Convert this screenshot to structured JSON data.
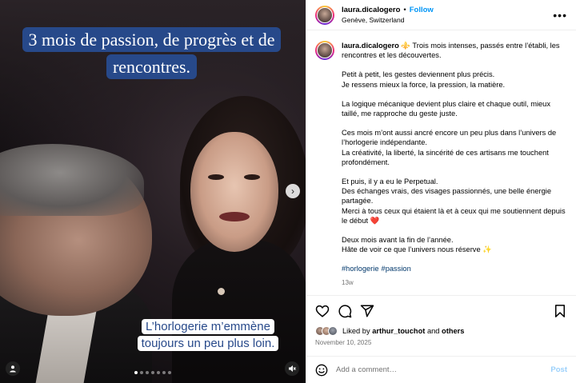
{
  "media": {
    "caption_top": "3 mois de passion, de progrès et de rencontres.",
    "caption_bottom": "L’horlogerie m’emmène toujours un peu plus loin.",
    "next_icon": "chevron-right-icon",
    "tag_icon": "user-tag-icon",
    "mute_icon": "speaker-muted-icon",
    "carousel_dots": 7,
    "active_dot": 0
  },
  "header": {
    "username": "laura.dicalogero",
    "separator": "•",
    "follow_label": "Follow",
    "location": "Genève, Switzerland",
    "more_icon": "more-horizontal-icon",
    "more_label": "•••"
  },
  "caption": {
    "username": "laura.dicalogero",
    "paragraphs": [
      "⚜️ Trois mois intenses, passés entre l’établi, les rencontres et les découvertes.",
      "Petit à petit, les gestes deviennent plus précis.\nJe ressens mieux la force, la pression, la matière.",
      "La logique mécanique devient plus claire et chaque outil, mieux taillé, me rapproche du geste juste.",
      "Ces mois m’ont aussi ancré encore un peu plus dans l’univers de l’horlogerie indépendante.\nLa créativité, la liberté, la sincérité de ces artisans me touchent profondément.",
      "Et puis, il y a eu le Perpetual.\nDes échanges vrais, des visages passionnés, une belle énergie partagée.\nMerci à tous ceux qui étaient là et à ceux qui me soutiennent depuis le début ❤️",
      "Deux mois avant la fin de l’année.\nHâte de voir ce que l’univers nous réserve ✨"
    ],
    "hashtags": [
      "#horlogerie",
      "#passion"
    ],
    "time_ago": "13w"
  },
  "actions": {
    "like_icon": "heart-icon",
    "comment_icon": "comment-icon",
    "share_icon": "send-icon",
    "save_icon": "bookmark-icon"
  },
  "likes": {
    "prefix": "Liked by",
    "user": "arthur_touchot",
    "conjunction": "and",
    "others": "others"
  },
  "date": "November 10, 2025",
  "comment_box": {
    "emoji_icon": "emoji-icon",
    "placeholder": "Add a comment…",
    "post_label": "Post"
  },
  "colors": {
    "caption_bg": "#27498a",
    "caption_text_bottom": "#27498a",
    "follow": "#0095f6",
    "hashtag": "#00376b",
    "post_disabled": "#9ad0fb"
  }
}
